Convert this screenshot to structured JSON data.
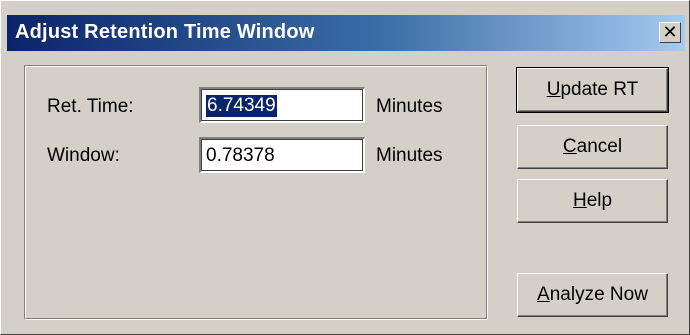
{
  "window": {
    "title": "Adjust Retention Time Window",
    "close_glyph": "✕"
  },
  "form": {
    "ret_time": {
      "label": "Ret. Time:",
      "value": "6.74349",
      "unit": "Minutes"
    },
    "window": {
      "label": "Window:",
      "value": "0.78378",
      "unit": "Minutes"
    }
  },
  "buttons": {
    "update_rt": {
      "mnemonic": "U",
      "rest": "pdate RT"
    },
    "cancel": {
      "mnemonic": "C",
      "rest": "ancel"
    },
    "help": {
      "mnemonic": "H",
      "rest": "elp"
    },
    "analyze_now": {
      "mnemonic": "A",
      "rest": "nalyze Now"
    }
  },
  "colors": {
    "dialog_bg": "#d4d0c8",
    "title_gradient_start": "#0a246a",
    "title_gradient_end": "#a6caf0",
    "selection_bg": "#0a246a"
  }
}
